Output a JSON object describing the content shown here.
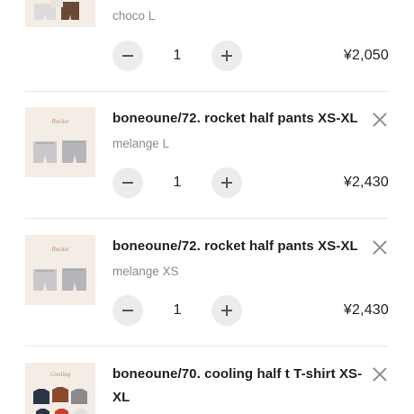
{
  "cart": {
    "items": [
      {
        "title": "",
        "variant": "choco L",
        "quantity": "1",
        "price": "¥2,050",
        "thumb": "rocket-pants"
      },
      {
        "title": "boneoune/72. rocket half pants XS-XL",
        "variant": "melange L",
        "quantity": "1",
        "price": "¥2,430",
        "thumb": "rocket-pants"
      },
      {
        "title": "boneoune/72. rocket half pants XS-XL",
        "variant": "melange XS",
        "quantity": "1",
        "price": "¥2,430",
        "thumb": "rocket-pants"
      },
      {
        "title": "boneoune/70. cooling half t T-shirt XS-XL",
        "variant": "",
        "quantity": "",
        "price": "",
        "thumb": "cooling-tshirt"
      }
    ],
    "icons": {
      "remove": "close-icon",
      "minus": "minus-icon",
      "plus": "plus-icon"
    },
    "colors": {
      "stepper_bg": "#ececec",
      "thumb_bg": "#f3ede6",
      "variant_text": "#8a8a8a"
    }
  }
}
